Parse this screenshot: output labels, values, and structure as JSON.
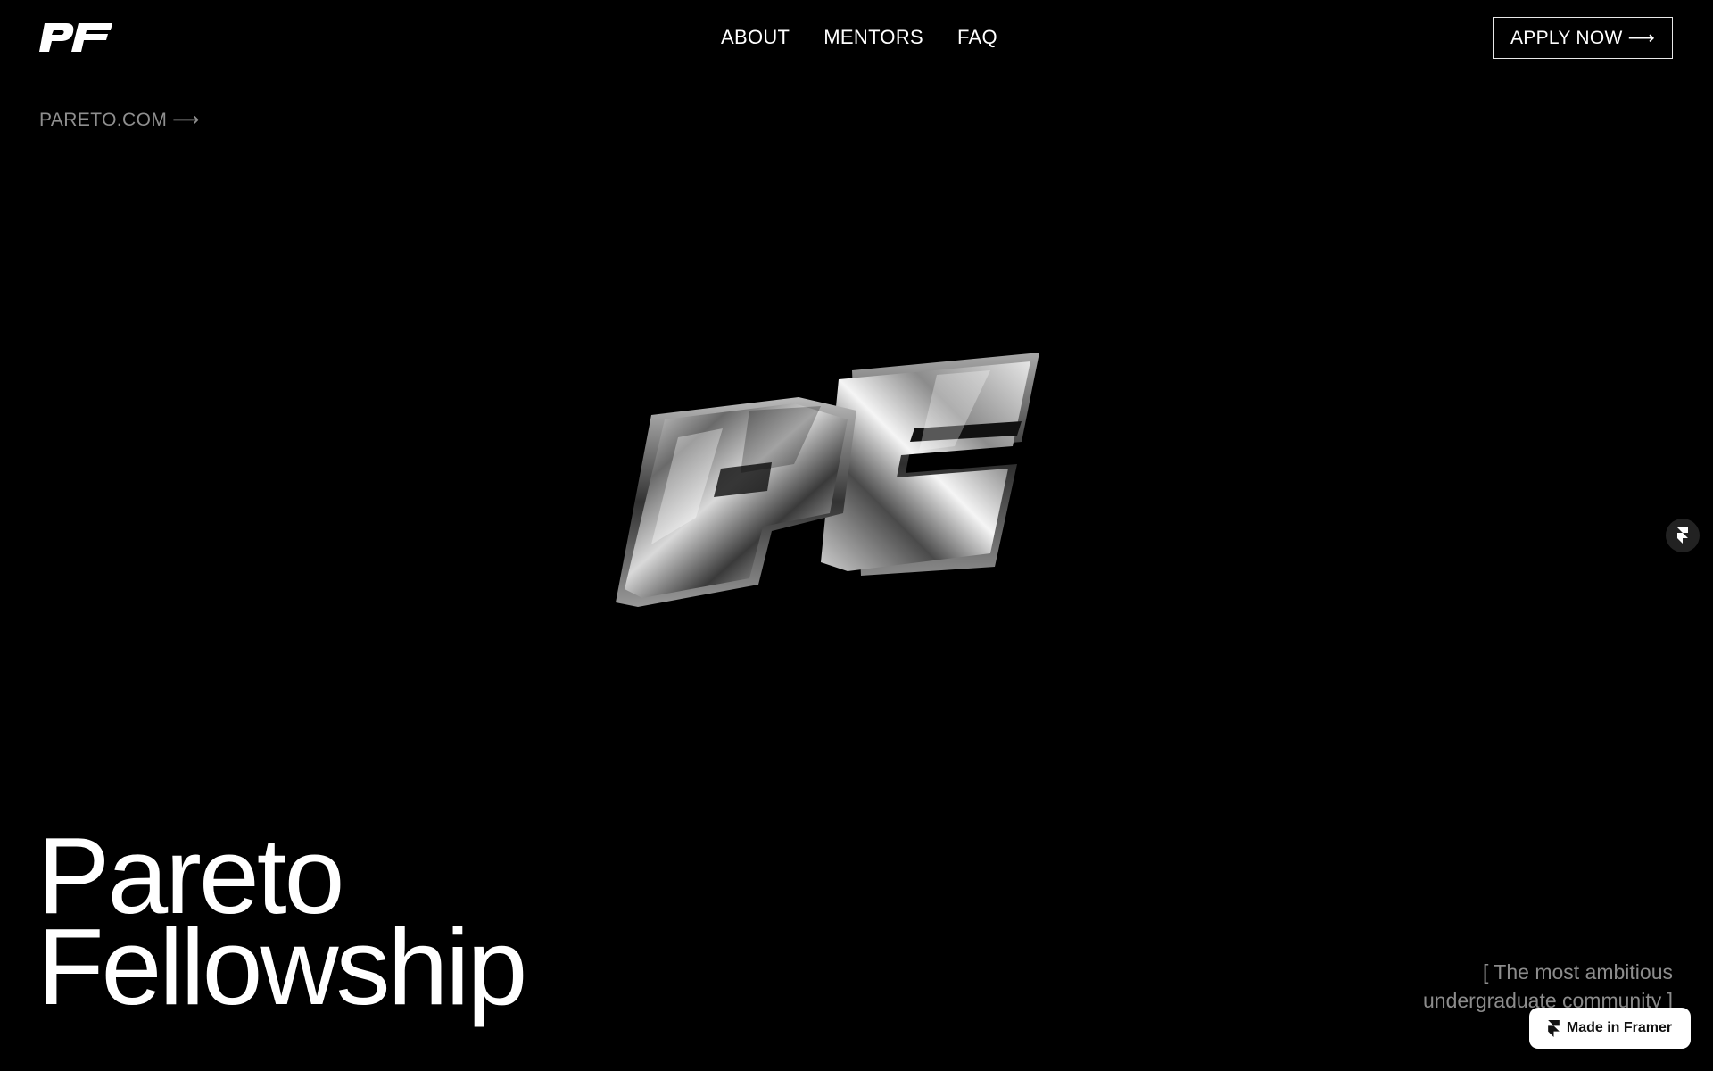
{
  "header": {
    "logo_text": "PF",
    "nav": [
      {
        "label": "ABOUT"
      },
      {
        "label": "MENTORS"
      },
      {
        "label": "FAQ"
      }
    ],
    "apply_label": "APPLY NOW",
    "apply_arrow": "⟶"
  },
  "site_link": {
    "label": "PARETO.COM",
    "arrow": "⟶"
  },
  "hero": {
    "logo_text": "PF",
    "title_line1": "Pareto",
    "title_line2": "Fellowship",
    "tagline_line1": "[ The most ambitious",
    "tagline_line2": "undergraduate community ]"
  },
  "badges": {
    "framer_label": "Made in Framer",
    "side_icon": "framer-icon"
  },
  "colors": {
    "background": "#000000",
    "text": "#ffffff",
    "muted": "#8f8f8f"
  }
}
